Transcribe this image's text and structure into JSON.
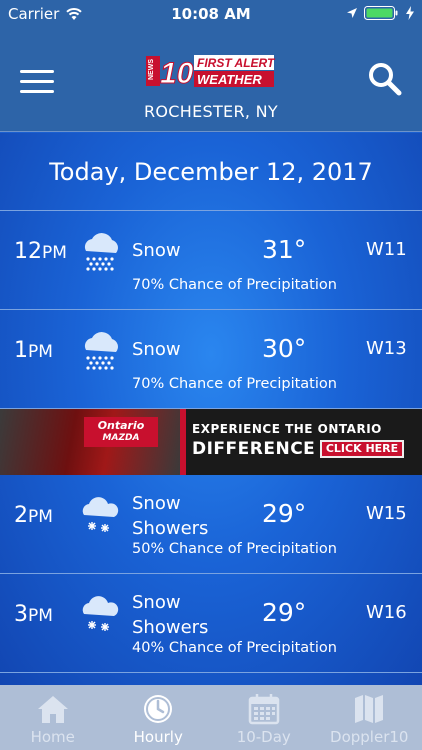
{
  "status_bar": {
    "carrier": "Carrier",
    "time": "10:08 AM"
  },
  "header": {
    "logo_text_1": "FIRST ALERT",
    "logo_text_2": "WEATHER",
    "logo_channel": "10",
    "logo_news": "NEWS",
    "location": "ROCHESTER, NY"
  },
  "date_heading": "Today, December 12, 2017",
  "hours": [
    {
      "hour": "12",
      "ampm": "PM",
      "condition": [
        "Snow"
      ],
      "temp": "31°",
      "wind": "W11",
      "precip": "70% Chance of Precipitation",
      "icon": "snow-cloud-icon"
    },
    {
      "hour": "1",
      "ampm": "PM",
      "condition": [
        "Snow"
      ],
      "temp": "30°",
      "wind": "W13",
      "precip": "70% Chance of Precipitation",
      "icon": "snow-cloud-icon"
    },
    {
      "hour": "2",
      "ampm": "PM",
      "condition": [
        "Snow",
        "Showers"
      ],
      "temp": "29°",
      "wind": "W15",
      "precip": "50% Chance of Precipitation",
      "icon": "snow-showers-icon"
    },
    {
      "hour": "3",
      "ampm": "PM",
      "condition": [
        "Snow",
        "Showers"
      ],
      "temp": "29°",
      "wind": "W16",
      "precip": "40% Chance of Precipitation",
      "icon": "snow-showers-icon"
    }
  ],
  "ad": {
    "brand_line1": "Ontario",
    "brand_line2": "MAZDA",
    "line1": "EXPERIENCE THE ONTARIO",
    "line2": "DIFFERENCE",
    "cta": "CLICK HERE"
  },
  "tabs": [
    {
      "label": "Home",
      "icon": "home-icon",
      "active": false
    },
    {
      "label": "Hourly",
      "icon": "clock-icon",
      "active": true
    },
    {
      "label": "10-Day",
      "icon": "calendar-icon",
      "active": false
    },
    {
      "label": "Doppler10",
      "icon": "map-icon",
      "active": false
    }
  ],
  "colors": {
    "header_bg": "#2d64a8",
    "content_blue": "#1a63d6",
    "tab_bar_bg": "#aebed6",
    "ad_red": "#c8102e"
  }
}
